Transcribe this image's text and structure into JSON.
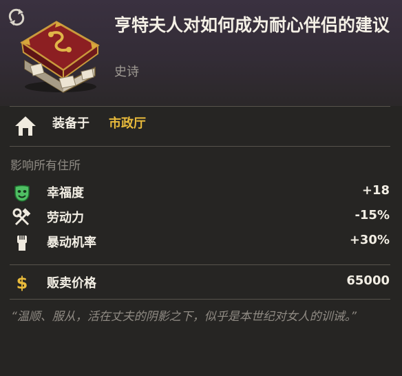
{
  "item": {
    "title": "亨特夫人对如何成为耐心伴侣的建议",
    "rarity": "史诗",
    "image_icon": "red-book-icon"
  },
  "header_icons": {
    "refresh": "refresh-icon"
  },
  "equip": {
    "label": "装备于",
    "value": "市政厅",
    "icon": "house-icon"
  },
  "effects": {
    "title": "影响所有住所",
    "stats": [
      {
        "icon": "happy-mask-icon",
        "label": "幸福度",
        "value": "+18"
      },
      {
        "icon": "hammer-wrench-icon",
        "label": "劳动力",
        "value": "-15%"
      },
      {
        "icon": "raised-fist-icon",
        "label": "暴动机率",
        "value": "+30%"
      }
    ]
  },
  "sell": {
    "icon": "dollar-icon",
    "label": "贩卖价格",
    "value": "65000"
  },
  "flavor_text": "“温顺、服从，活在丈夫的阴影之下，似乎是本世纪对女人的训诫。”",
  "colors": {
    "background": "#262523",
    "header": "#3a3140",
    "gold": "#e9bb3b",
    "muted": "#908b84",
    "book_red": "#8c1f22"
  }
}
